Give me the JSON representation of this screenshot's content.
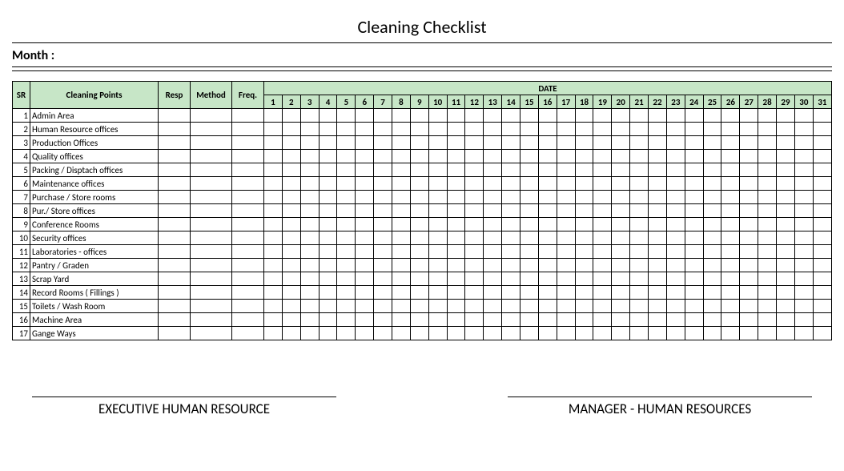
{
  "title": "Cleaning Checklist",
  "month_label": "Month :",
  "headers": {
    "sr": "SR",
    "cleaning_points": "Cleaning Points",
    "resp": "Resp",
    "method": "Method",
    "freq": "Freq.",
    "date": "DATE"
  },
  "days": [
    "1",
    "2",
    "3",
    "4",
    "5",
    "6",
    "7",
    "8",
    "9",
    "10",
    "11",
    "12",
    "13",
    "14",
    "15",
    "16",
    "17",
    "18",
    "19",
    "20",
    "21",
    "22",
    "23",
    "24",
    "25",
    "26",
    "27",
    "28",
    "29",
    "30",
    "31"
  ],
  "rows": [
    {
      "sr": "1",
      "cp": "Admin Area"
    },
    {
      "sr": "2",
      "cp": "Human Resource offices"
    },
    {
      "sr": "3",
      "cp": "Production Offices"
    },
    {
      "sr": "4",
      "cp": "Quality offices"
    },
    {
      "sr": "5",
      "cp": "Packing / Disptach offices"
    },
    {
      "sr": "6",
      "cp": "Maintenance offices"
    },
    {
      "sr": "7",
      "cp": "Purchase / Store rooms"
    },
    {
      "sr": "8",
      "cp": "Pur./ Store offices"
    },
    {
      "sr": "9",
      "cp": "Conference Rooms"
    },
    {
      "sr": "10",
      "cp": "Security offices"
    },
    {
      "sr": "11",
      "cp": "Laboratories - offices"
    },
    {
      "sr": "12",
      "cp": "Pantry / Graden"
    },
    {
      "sr": "13",
      "cp": "Scrap Yard"
    },
    {
      "sr": "14",
      "cp": "Record Rooms ( Fillings )"
    },
    {
      "sr": "15",
      "cp": "Toilets / Wash Room"
    },
    {
      "sr": "16",
      "cp": "Machine Area"
    },
    {
      "sr": "17",
      "cp": "Gange Ways"
    }
  ],
  "signatures": {
    "left": "EXECUTIVE HUMAN RESOURCE",
    "right": "MANAGER - HUMAN RESOURCES"
  }
}
